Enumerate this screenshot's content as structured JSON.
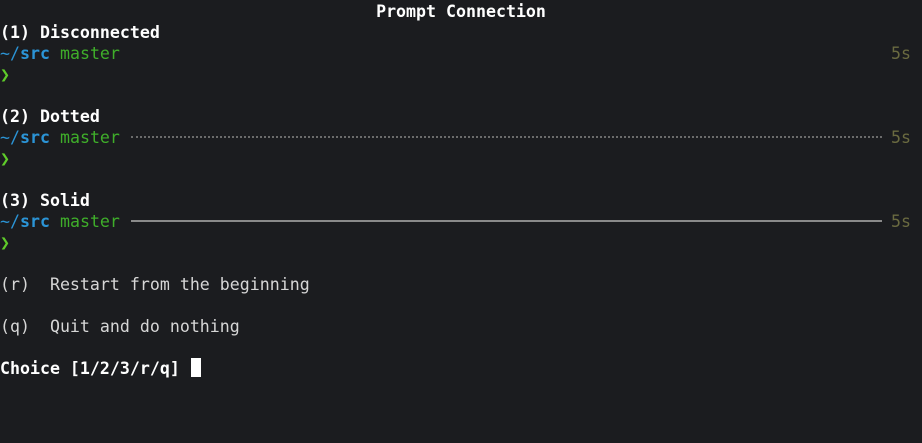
{
  "title": "Prompt Connection",
  "options": [
    {
      "label": "(1) Disconnected",
      "style": "none"
    },
    {
      "label": "(2) Dotted",
      "style": "dotted"
    },
    {
      "label": "(3) Solid",
      "style": "solid"
    }
  ],
  "prompt": {
    "tilde": "~/",
    "dir": "src",
    "branch": "master",
    "duration": "5s",
    "chevron": "❯"
  },
  "actions": [
    {
      "label": "(r)  Restart from the beginning"
    },
    {
      "label": "(q)  Quit and do nothing"
    }
  ],
  "choice_prompt": "Choice [1/2/3/r/q] ",
  "colors": {
    "background": "#1b1c1f",
    "dir_blue": "#2b94d6",
    "branch_green": "#3fae2a",
    "chevron_green": "#5fcc2a",
    "duration_olive": "#6a6a40"
  }
}
